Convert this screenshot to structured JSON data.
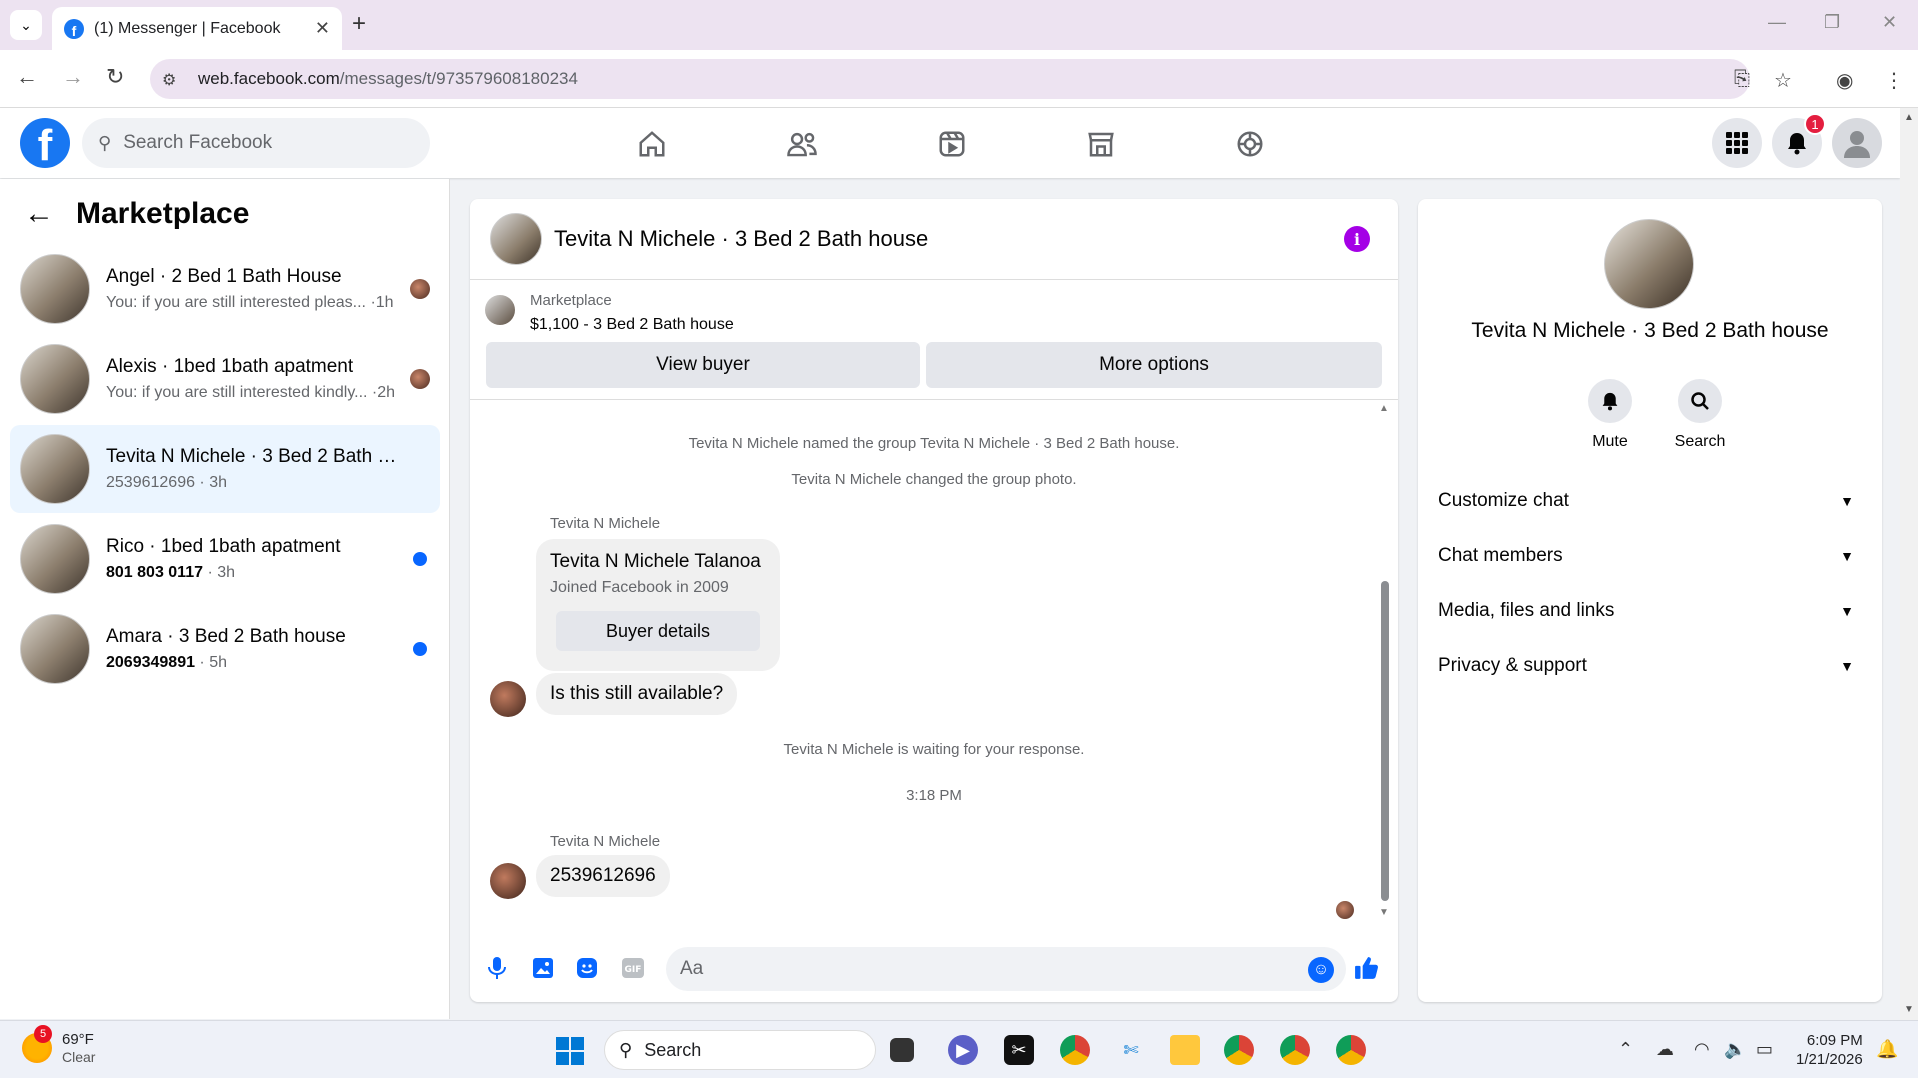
{
  "browser": {
    "tab_title": "(1) Messenger | Facebook",
    "url_host": "web.facebook.com",
    "url_path": "/messages/t/973579608180234"
  },
  "fb_header": {
    "search_placeholder": "Search Facebook",
    "notification_count": "1"
  },
  "left_panel": {
    "title": "Marketplace",
    "conversations": [
      {
        "name": "Angel · 2 Bed 1 Bath House",
        "snippet": "You: if you are still interested pleas...",
        "time": " ·1h",
        "indicator": "avatar",
        "active": false
      },
      {
        "name": "Alexis · 1bed 1bath apatment",
        "snippet": "You: if you are still interested kindly...",
        "time": " ·2h",
        "indicator": "avatar",
        "active": false
      },
      {
        "name": "Tevita N Michele · 3 Bed 2 Bath ho...",
        "snippet": "2539612696",
        "time": " · 3h",
        "indicator": "none",
        "active": true
      },
      {
        "name": "Rico · 1bed 1bath apatment",
        "snippet": "801 803 0117",
        "time": " · 3h",
        "indicator": "unread",
        "active": false
      },
      {
        "name": "Amara · 3 Bed 2 Bath house",
        "snippet": "2069349891",
        "time": " · 5h",
        "indicator": "unread",
        "active": false
      }
    ]
  },
  "chat": {
    "title": "Tevita N Michele · 3 Bed 2 Bath house",
    "marketplace_label": "Marketplace",
    "listing": "$1,100 - 3 Bed 2 Bath house",
    "view_buyer": "View buyer",
    "more_options": "More options",
    "sys_named": "Tevita N Michele named the group Tevita N Michele · 3 Bed 2 Bath house.",
    "sys_photo": "Tevita N Michele changed the group photo.",
    "sender1": "Tevita N Michele",
    "card_name": "Tevita N Michele Talanoa",
    "card_joined": "Joined Facebook in 2009",
    "card_button": "Buyer details",
    "msg1": "Is this still available?",
    "sys_waiting": "Tevita N Michele is waiting for your response.",
    "timestamp": "3:18 PM",
    "sender2": "Tevita N Michele",
    "msg2": "2539612696",
    "composer_placeholder": "Aa"
  },
  "right_panel": {
    "name": "Tevita N Michele · 3 Bed 2 Bath house",
    "mute": "Mute",
    "search": "Search",
    "sections": [
      "Customize chat",
      "Chat members",
      "Media, files and links",
      "Privacy & support"
    ]
  },
  "taskbar": {
    "weather_temp": "69°F",
    "weather_desc": "Clear",
    "weather_badge": "5",
    "search_label": "Search",
    "time": "6:09 PM",
    "date": "1/21/2026"
  }
}
